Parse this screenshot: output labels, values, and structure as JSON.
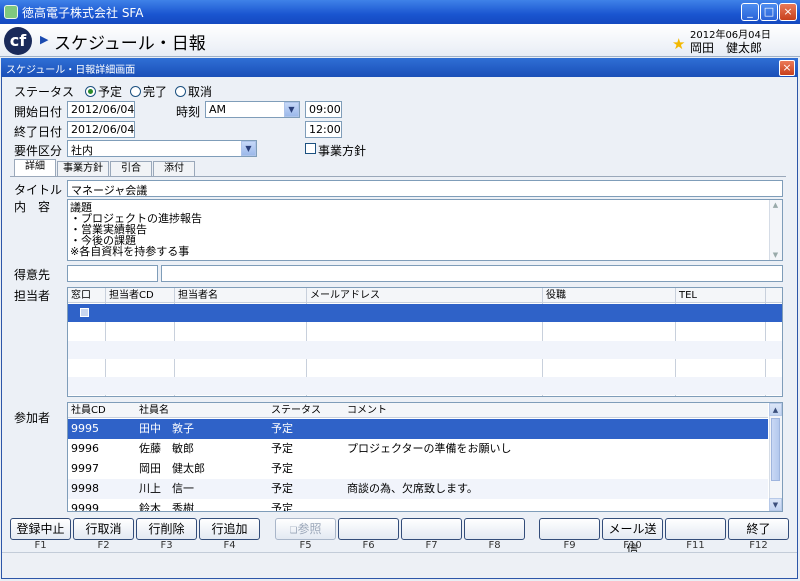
{
  "window": {
    "title": "徳高電子株式会社 SFA",
    "minimize": "_",
    "maximize": "□",
    "close": "×"
  },
  "header": {
    "logo": "cf",
    "title": "スケジュール・日報",
    "date": "2012年06月04日",
    "user": "岡田　健太郎"
  },
  "dialog": {
    "title": "スケジュール・日報詳細画面",
    "close": "×"
  },
  "form": {
    "status_label": "ステータス",
    "status_options": [
      "予定",
      "完了",
      "取消"
    ],
    "status_selected": "予定",
    "start_date_label": "開始日付",
    "start_date": "2012/06/04",
    "end_date_label": "終了日付",
    "end_date": "2012/06/04",
    "time_label": "時刻",
    "time_period": "AM",
    "start_time": "09:00",
    "end_time": "12:00",
    "category_label": "要件区分",
    "category": "社内",
    "business_policy_label": "事業方針",
    "business_policy_checked": false
  },
  "tabs": [
    "詳細",
    "事業方針",
    "引合",
    "添付"
  ],
  "detail": {
    "title_label": "タイトル",
    "title": "マネージャ会議",
    "content_label": "内　容",
    "content_lines": [
      "議題",
      "・プロジェクトの進捗報告",
      "・営業実績報告",
      "・今後の課題",
      "※各自資料を持参する事"
    ],
    "customer_label": "得意先",
    "customer_code": "",
    "customer_name": ""
  },
  "staff": {
    "label": "担当者",
    "columns": [
      "窓口",
      "担当者CD",
      "担当者名",
      "メールアドレス",
      "役職",
      "TEL"
    ]
  },
  "participants": {
    "label": "参加者",
    "columns": [
      "社員CD",
      "社員名",
      "ステータス",
      "コメント"
    ],
    "rows": [
      {
        "cd": "9995",
        "name": "田中　敦子",
        "status": "予定",
        "comment": ""
      },
      {
        "cd": "9996",
        "name": "佐藤　敏郎",
        "status": "予定",
        "comment": "プロジェクターの準備をお願いし"
      },
      {
        "cd": "9997",
        "name": "岡田　健太郎",
        "status": "予定",
        "comment": ""
      },
      {
        "cd": "9998",
        "name": "川上　信一",
        "status": "予定",
        "comment": "商談の為、欠席致します。"
      },
      {
        "cd": "9999",
        "name": "鈴木　秀樹",
        "status": "予定",
        "comment": ""
      }
    ]
  },
  "fbuttons": [
    {
      "label": "登録中止",
      "key": "F1"
    },
    {
      "label": "行取消",
      "key": "F2"
    },
    {
      "label": "行削除",
      "key": "F3"
    },
    {
      "label": "行追加",
      "key": "F4"
    },
    {
      "label": "参照",
      "key": "F5"
    },
    {
      "label": "",
      "key": "F6"
    },
    {
      "label": "",
      "key": "F7"
    },
    {
      "label": "",
      "key": "F8"
    },
    {
      "label": "",
      "key": "F9"
    },
    {
      "label": "メール送信",
      "key": "F10"
    },
    {
      "label": "",
      "key": "F11"
    },
    {
      "label": "終了",
      "key": "F12"
    }
  ],
  "icons": [
    "app-icon",
    "logo-icon",
    "arrow-icon",
    "star-icon",
    "dropdown-icon",
    "scroll-up-icon",
    "scroll-down-icon",
    "reference-icon"
  ]
}
